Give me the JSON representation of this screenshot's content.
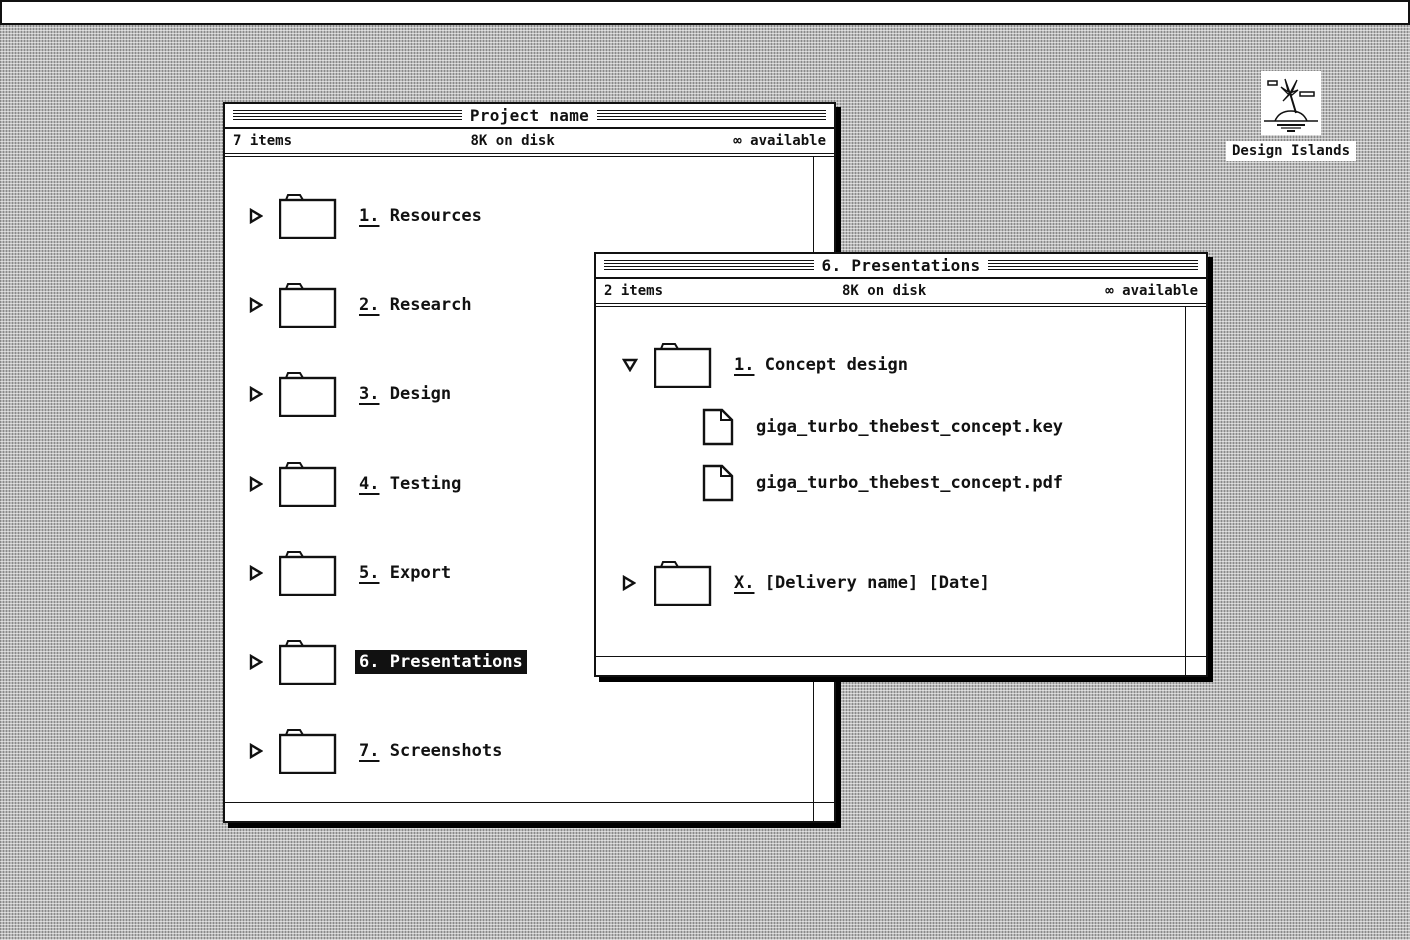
{
  "menubar": {},
  "desktop": {
    "icons": [
      {
        "label": "Design Islands",
        "icon": "island-icon"
      }
    ]
  },
  "windows": {
    "project": {
      "title": "Project name",
      "info": {
        "items": "7 items",
        "disk": "8K on disk",
        "available": "∞ available"
      },
      "rows": [
        {
          "num": "1.",
          "name": "Resources",
          "expanded": false,
          "selected": false
        },
        {
          "num": "2.",
          "name": "Research",
          "expanded": false,
          "selected": false
        },
        {
          "num": "3.",
          "name": "Design",
          "expanded": false,
          "selected": false
        },
        {
          "num": "4.",
          "name": "Testing",
          "expanded": false,
          "selected": false
        },
        {
          "num": "5.",
          "name": "Export",
          "expanded": false,
          "selected": false
        },
        {
          "num": "6.",
          "name": "Presentations",
          "expanded": false,
          "selected": true
        },
        {
          "num": "7.",
          "name": "Screenshots",
          "expanded": false,
          "selected": false
        }
      ]
    },
    "presentations": {
      "title": "6. Presentations",
      "info": {
        "items": "2 items",
        "disk": "8K on disk",
        "available": "∞ available"
      },
      "folders": [
        {
          "num": "1.",
          "name": "Concept design",
          "expanded": true,
          "files": [
            {
              "name": "giga_turbo_thebest_concept.key"
            },
            {
              "name": "giga_turbo_thebest_concept.pdf"
            }
          ]
        },
        {
          "num": "X.",
          "name": "[Delivery name] [Date]",
          "expanded": false,
          "files": []
        }
      ]
    }
  }
}
